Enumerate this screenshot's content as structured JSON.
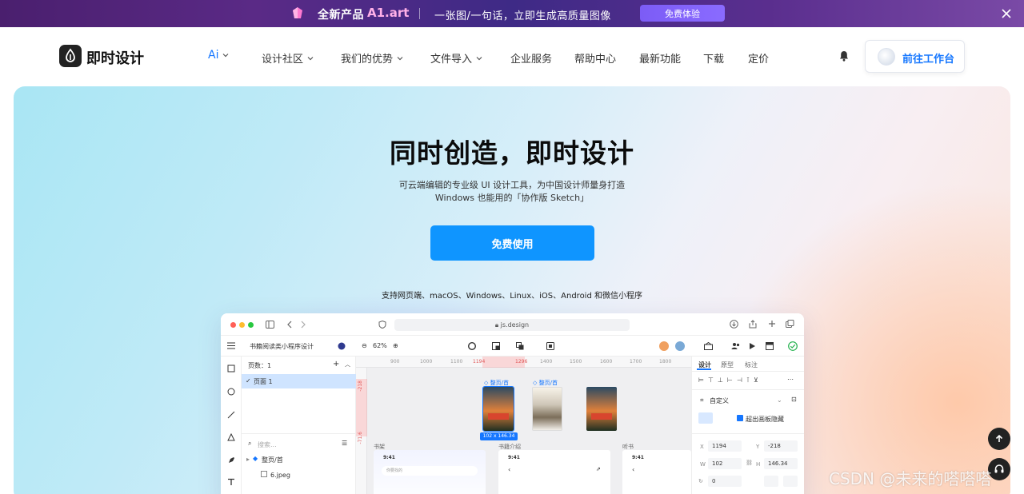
{
  "banner": {
    "new_label": "全新产品",
    "brand": "A1.art",
    "slogan": "一张图/一句话，立即生成高质量图像",
    "try_button": "免费体验"
  },
  "nav": {
    "logo_text": "即时设计",
    "items": [
      {
        "label": "Ai",
        "has_menu": true
      },
      {
        "label": "设计社区",
        "has_menu": true
      },
      {
        "label": "我们的优势",
        "has_menu": true
      },
      {
        "label": "文件导入",
        "has_menu": true
      },
      {
        "label": "企业服务",
        "has_menu": false
      },
      {
        "label": "帮助中心",
        "has_menu": false
      },
      {
        "label": "最新功能",
        "has_menu": false
      },
      {
        "label": "下载",
        "has_menu": false
      },
      {
        "label": "定价",
        "has_menu": false
      }
    ],
    "workbench_button": "前往工作台"
  },
  "hero": {
    "title": "同时创造，即时设计",
    "subtitle_line1": "可云端编辑的专业级 UI 设计工具，为中国设计师量身打造",
    "subtitle_line2": "Windows 也能用的「协作版 Sketch」",
    "cta": "免费使用",
    "platforms": "支持网页端、macOS、Windows、Linux、iOS、Android 和微信小程序"
  },
  "app": {
    "url": "js.design",
    "file_name": "书籍阅读类小程序设计",
    "zoom": "62%",
    "pages_label": "页数：1",
    "page_item": "页面 1",
    "search_placeholder": "搜索...",
    "layer_group": "整页/首",
    "layer_image": "6.jpeg",
    "ruler": [
      "900",
      "1000",
      "1100",
      "1194",
      "1296",
      "1400",
      "1500",
      "1600",
      "1700",
      "1800"
    ],
    "ruler_v": [
      "-218",
      "-71.6"
    ],
    "frame_labels": [
      "整页/首",
      "整页/首"
    ],
    "size_badge": "102 x 146.34",
    "section_labels": [
      "书架",
      "书籍介绍",
      "听书"
    ],
    "time": "9:41",
    "search_hint": "你要找的",
    "tabs": [
      "设计",
      "原型",
      "标注"
    ],
    "preset": "自定义",
    "clip_label": "超出画板隐藏",
    "x_label": "X",
    "x_value": "1194",
    "y_label": "Y",
    "y_value": "-218",
    "w_label": "W",
    "w_value": "102",
    "h_label": "H",
    "h_value": "146.34",
    "rotation": "0"
  },
  "watermark": "CSDN @未来的嗒嗒嗒",
  "colors": {
    "accent": "#1677ff",
    "cta": "#0f95ff",
    "banner_start": "#4a1f6e",
    "banner_end": "#7a4aa6"
  }
}
